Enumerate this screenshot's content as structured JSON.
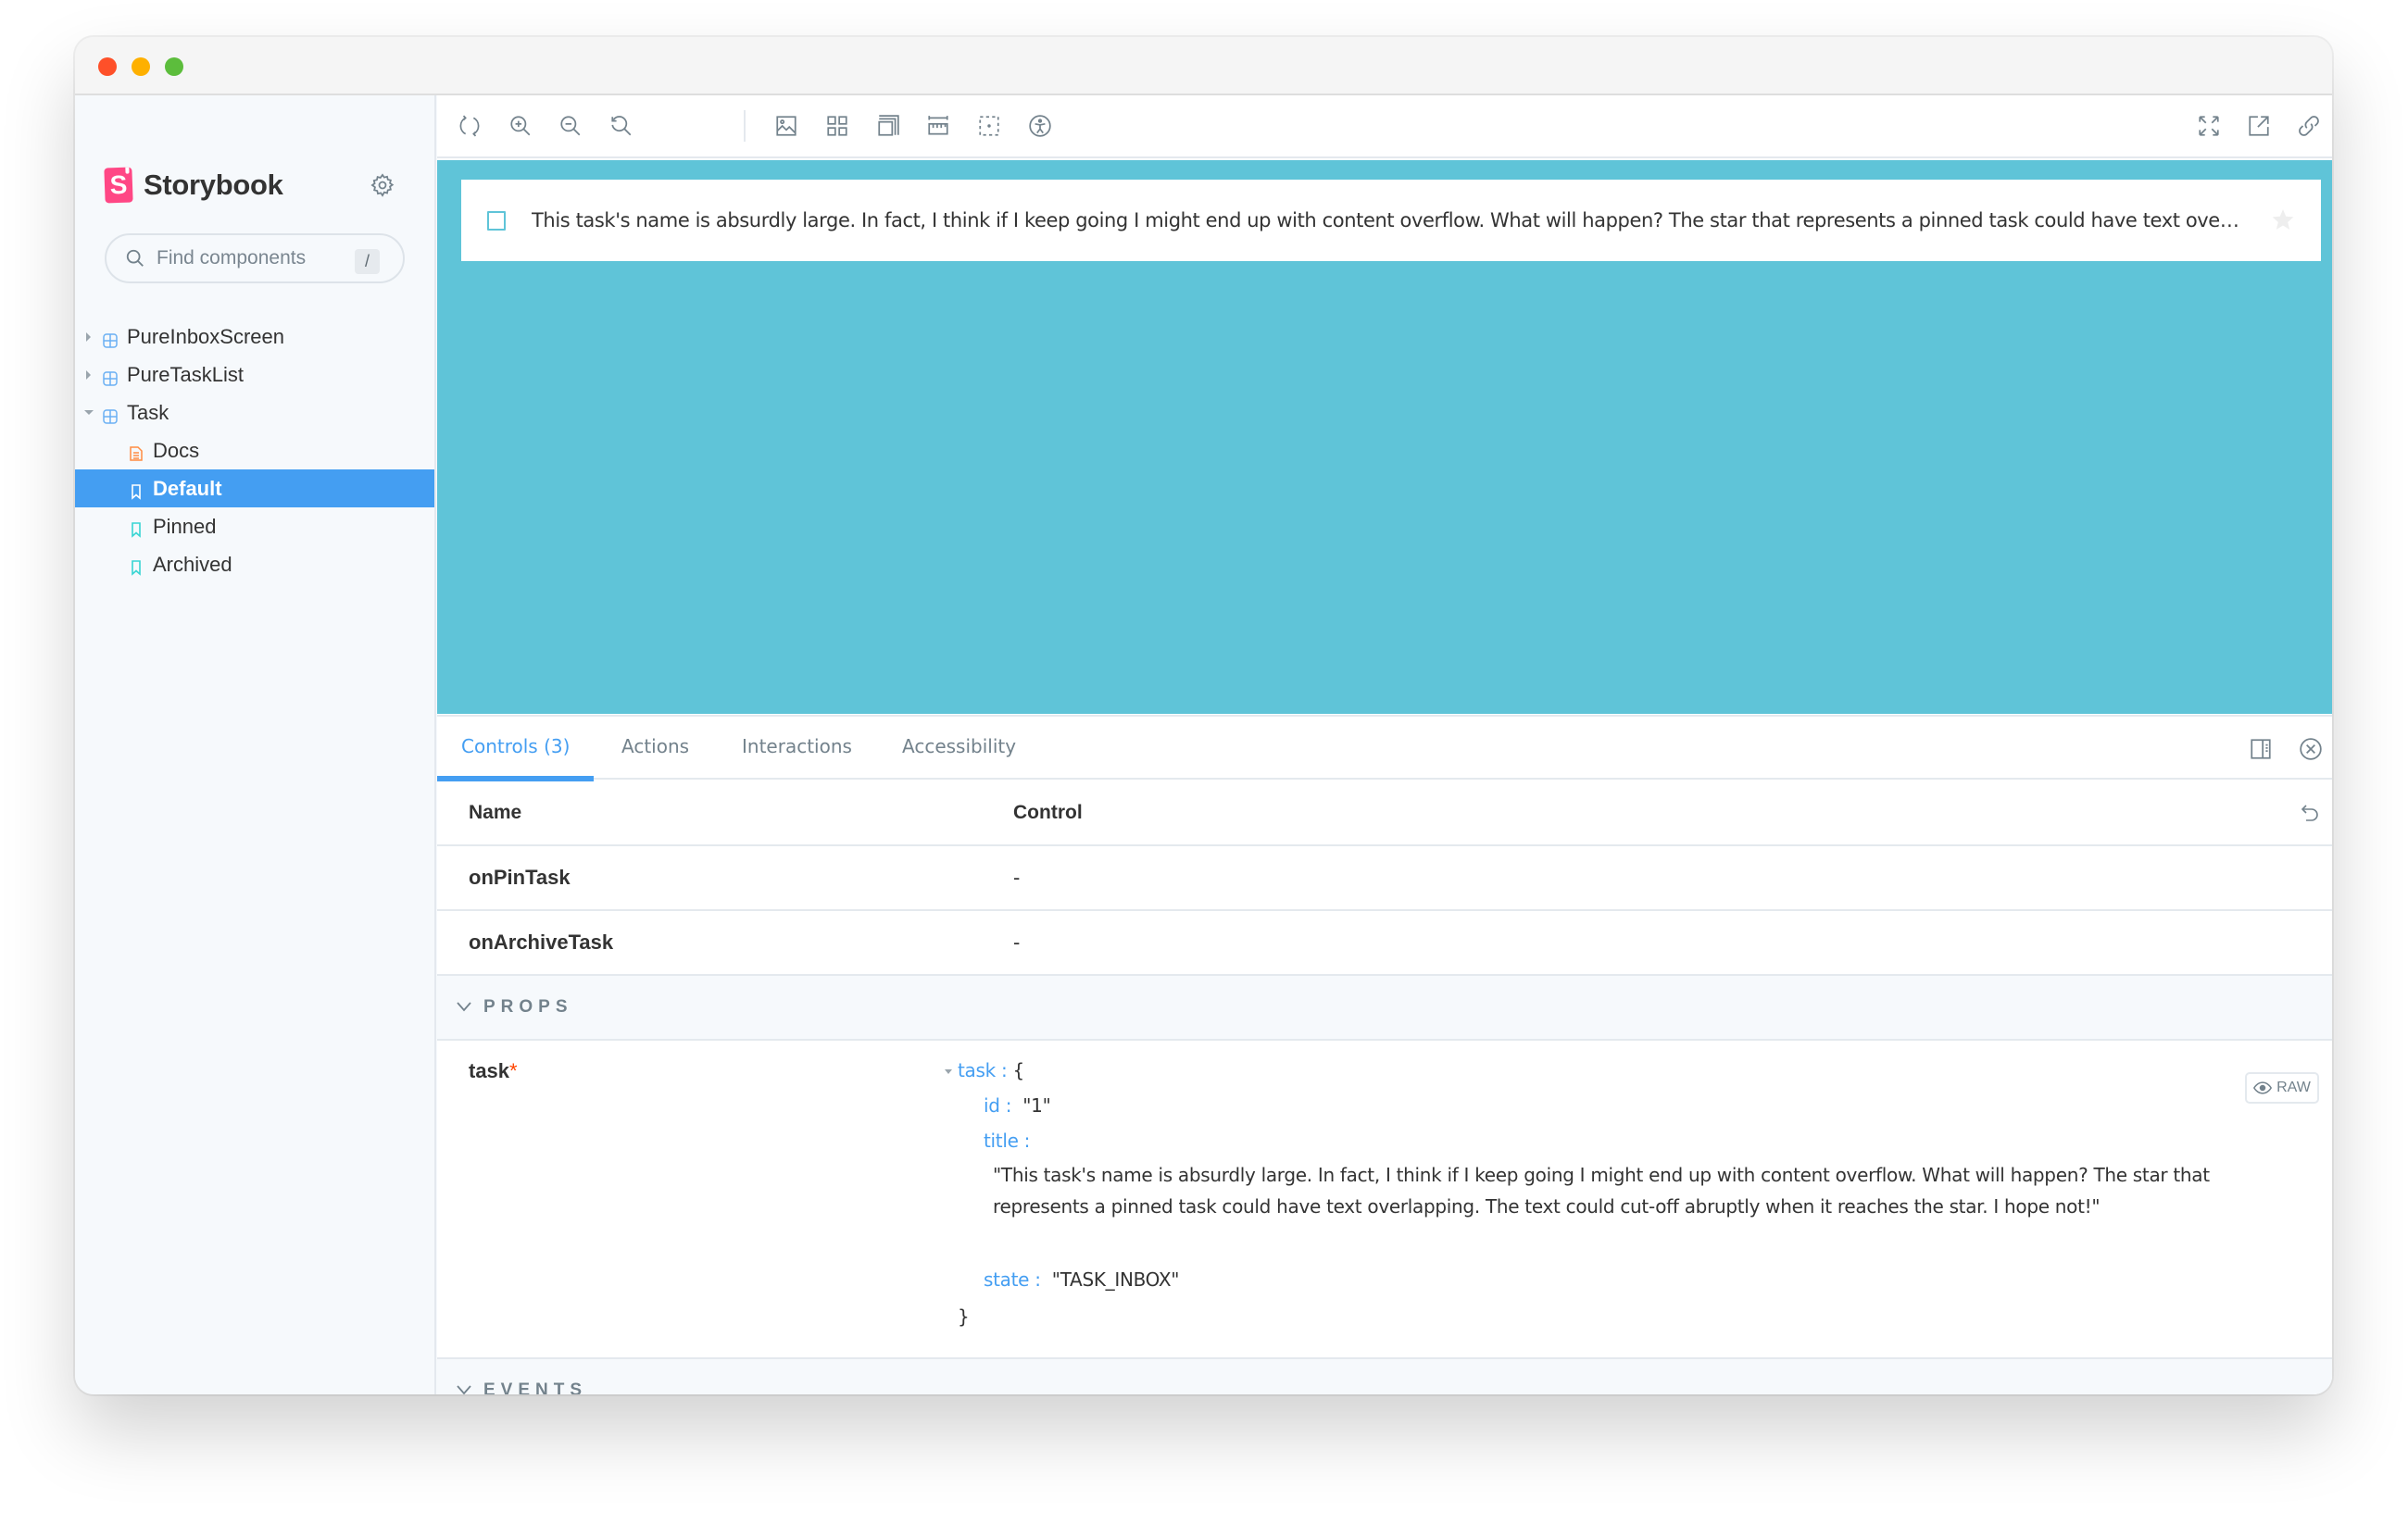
{
  "window": {
    "traffic_lights": [
      "close",
      "minimize",
      "maximize"
    ]
  },
  "sidebar": {
    "brand": {
      "logo_letter": "S",
      "name": "Storybook"
    },
    "settings_icon": "gear-icon",
    "search": {
      "placeholder": "Find components",
      "value": "",
      "shortcut": "/"
    },
    "tree": [
      {
        "label": "PureInboxScreen",
        "type": "component",
        "expanded": false
      },
      {
        "label": "PureTaskList",
        "type": "component",
        "expanded": false
      },
      {
        "label": "Task",
        "type": "component",
        "expanded": true
      },
      {
        "label": "Docs",
        "type": "docs"
      },
      {
        "label": "Default",
        "type": "story",
        "selected": true
      },
      {
        "label": "Pinned",
        "type": "story"
      },
      {
        "label": "Archived",
        "type": "story"
      }
    ]
  },
  "toolbar": {
    "left_icons": [
      "reload-icon",
      "zoom-in-icon",
      "zoom-out-icon",
      "zoom-reset-icon",
      "background-icon",
      "grid-icon",
      "outline-icon",
      "measure-icon",
      "viewport-icon",
      "accessibility-icon"
    ],
    "right_icons": [
      "fullscreen-icon",
      "open-new-tab-icon",
      "copy-link-icon"
    ]
  },
  "preview": {
    "background_color": "#5fc4d8",
    "task": {
      "checked": false,
      "title": "This task's name is absurdly large. In fact, I think if I keep going I might end up with content overflow. What will happen? The star that represents a pinned task could have text overlapping. The text could cut-off abruptly when it reaches the star. I hope not!",
      "pinned": false
    }
  },
  "panel": {
    "tabs": [
      {
        "label": "Controls (3)",
        "active": true
      },
      {
        "label": "Actions",
        "active": false
      },
      {
        "label": "Interactions",
        "active": false
      },
      {
        "label": "Accessibility",
        "active": false
      }
    ],
    "table": {
      "headers": {
        "name": "Name",
        "control": "Control"
      },
      "rows": [
        {
          "name": "onPinTask",
          "control": "-"
        },
        {
          "name": "onArchiveTask",
          "control": "-"
        }
      ],
      "sections": [
        {
          "label": "PROPS",
          "expanded": true
        },
        {
          "label": "EVENTS",
          "expanded": true
        }
      ],
      "task_prop": {
        "name": "task",
        "required_marker": "*",
        "object_key": "task",
        "open_brace": "{",
        "close_brace": "}",
        "fields": {
          "id": {
            "key": "id :",
            "value": "\"1\""
          },
          "title": {
            "key": "title :",
            "value": "\"This task's name is absurdly large. In fact, I think if I keep going I might end up with content overflow. What will happen? The star that represents a pinned task could have text overlapping. The text could cut-off abruptly when it reaches the star. I hope not!\""
          },
          "state": {
            "key": "state :",
            "value": "\"TASK_INBOX\""
          }
        },
        "raw_button": "RAW"
      }
    }
  },
  "colors": {
    "accent": "#449ef2",
    "storybook_pink": "#ff4785",
    "preview_bg": "#5fc4d8",
    "docs_icon": "#ff8c42",
    "story_icon": "#37d5d3",
    "required": "#ff4400"
  }
}
